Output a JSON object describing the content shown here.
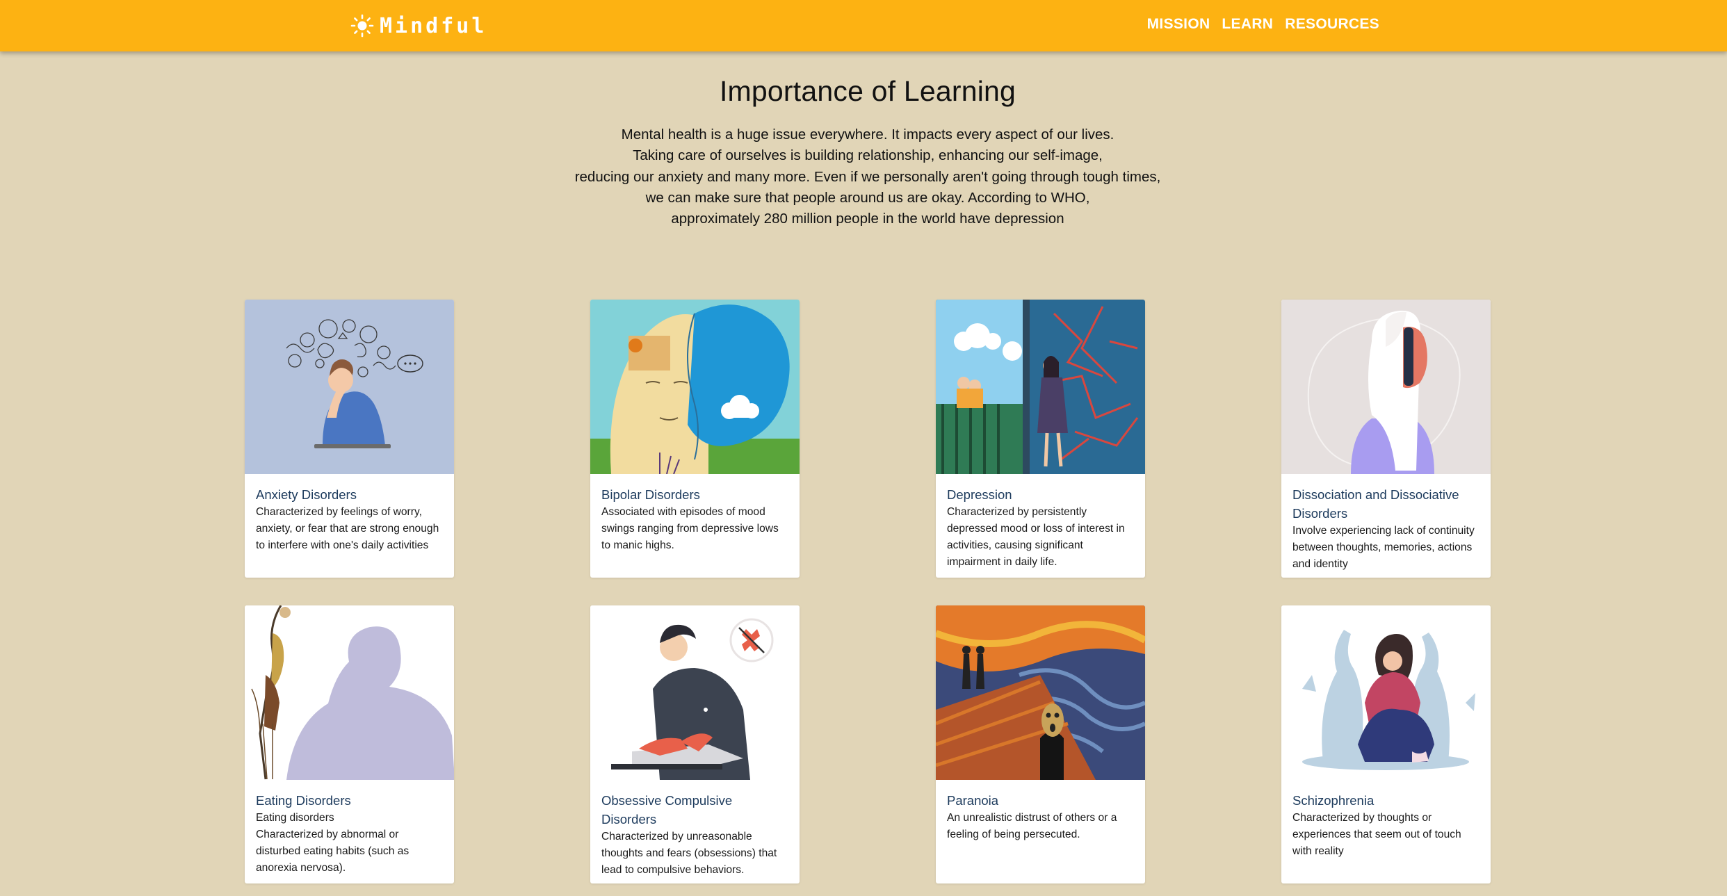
{
  "nav": {
    "brand": "Mindful",
    "links": [
      "MISSION",
      "LEARN",
      "RESOURCES"
    ]
  },
  "intro": {
    "title": "Importance of Learning",
    "lines": [
      "Mental health is a huge issue everywhere. It impacts every aspect of our lives.",
      "Taking care of ourselves is building relationship, enhancing our self-image,",
      "reducing our anxiety and many more. Even if we personally aren't going through tough times,",
      "we can make sure that people around us are okay. According to WHO,",
      "approximately 280 million people in the world have depression"
    ]
  },
  "cards": [
    {
      "title": "Anxiety Disorders",
      "text": "Characterized by feelings of worry, anxiety, or fear that are strong enough to interfere with one's daily activities"
    },
    {
      "title": "Bipolar Disorders",
      "text": "Associated with episodes of mood swings ranging from depressive lows to manic highs."
    },
    {
      "title": "Depression",
      "text": "Characterized by persistently depressed mood or loss of interest in activities, causing significant impairment in daily life."
    },
    {
      "title": "Dissociation and Dissociative Disorders",
      "text": "Involve experiencing lack of continuity between thoughts, memories, actions and identity"
    },
    {
      "title": "Eating Disorders",
      "text": "Eating disorders\nCharacterized by abnormal or disturbed eating habits (such as anorexia nervosa)."
    },
    {
      "title": "Obsessive Compulsive Disorders",
      "text": "Characterized by unreasonable thoughts and fears (obsessions) that lead to compulsive behaviors."
    },
    {
      "title": "Paranoia",
      "text": "An unrealistic distrust of others or a feeling of being persecuted."
    },
    {
      "title": "Schizophrenia",
      "text": "Characterized by thoughts or experiences that seem out of touch with reality"
    }
  ],
  "colors": {
    "navbar": "#fdb212",
    "background": "#e1d5b7",
    "card_title": "#1c3a5c"
  },
  "icons": {
    "brand": "sun-icon"
  }
}
